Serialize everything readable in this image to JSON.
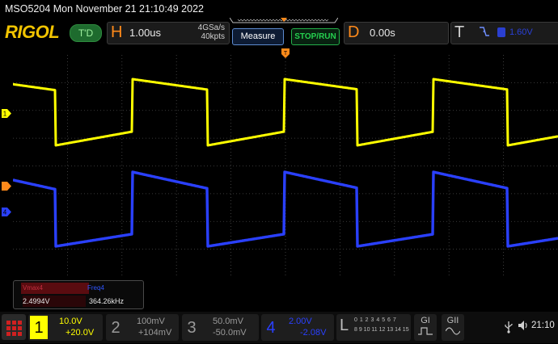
{
  "titlebar": {
    "text": "MSO5204  Mon November 21 21:10:49 2022"
  },
  "logo": "RIGOL",
  "td_label": "T'D",
  "horizontal": {
    "letter": "H",
    "scale": "1.00us",
    "sample_rate": "4GSa/s",
    "memory": "40kpts"
  },
  "buttons": {
    "measure": "Measure",
    "stop_run": "STOP/RUN"
  },
  "delay": {
    "letter": "D",
    "value": "0.00s"
  },
  "trigger": {
    "letter": "T",
    "slope": "f",
    "level": "1.60V"
  },
  "measurement": {
    "items": [
      {
        "name": "Vmax4",
        "value": "2.4994V"
      },
      {
        "name": "Freq4",
        "value": "364.26kHz"
      }
    ]
  },
  "channels": [
    {
      "num": "1",
      "scale": "10.0V",
      "offset": "+20.0V",
      "color": "#ffff00",
      "active": true
    },
    {
      "num": "2",
      "scale": "100mV",
      "offset": "+104mV",
      "color": "#9a9a9a",
      "active": false
    },
    {
      "num": "3",
      "scale": "50.0mV",
      "offset": "-50.0mV",
      "color": "#9a9a9a",
      "active": false
    },
    {
      "num": "4",
      "scale": "2.00V",
      "offset": "-2.08V",
      "color": "#2a40ff",
      "active": true
    }
  ],
  "logic": {
    "letter": "L",
    "row1": "0 1 2 3  4 5 6 7",
    "row2": "8 9 10 11 12 13 14 15"
  },
  "generators": [
    "GI",
    "GII"
  ],
  "status": {
    "time": "21:10"
  },
  "markers": {
    "ch1": "1",
    "ch4": "4",
    "trig": "T"
  },
  "colors": {
    "ch1": "#ffff00",
    "ch4": "#2a40ff",
    "accent": "#ff8a1a",
    "grid": "#5a5a5a"
  }
}
